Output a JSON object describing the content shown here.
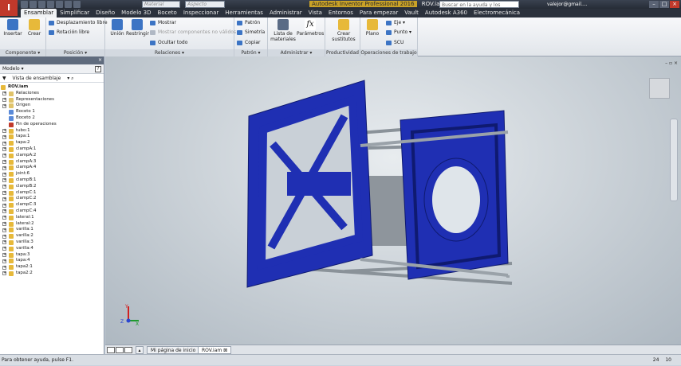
{
  "titlebar": {
    "material_placeholder": "Material",
    "appearance_placeholder": "Aspecto",
    "product": "Autodesk Inventor Professional 2016",
    "document": "ROV.iam",
    "search_placeholder": "Buscar en la ayuda y los comandos...",
    "user": "valejor@gmail...."
  },
  "tabs": [
    "Ensamblar",
    "Simplificar",
    "Diseño",
    "Modelo 3D",
    "Boceto",
    "Inspeccionar",
    "Herramientas",
    "Administrar",
    "Vista",
    "Entornos",
    "Para empezar",
    "Vault",
    "Autodesk A360",
    "Electromecánica"
  ],
  "ribbon": {
    "componente": {
      "label": "Componente ▾",
      "insertar": "Insertar",
      "crear": "Crear"
    },
    "posicion": {
      "label": "Posición ▾",
      "desplazamiento": "Desplazamiento libre",
      "rotacion": "Rotación libre"
    },
    "relaciones": {
      "label": "Relaciones ▾",
      "union": "Unión",
      "restringir": "Restringir",
      "mostrar": "Mostrar",
      "mostrar_comp": "Mostrar componentes no válidos",
      "ocultar": "Ocultar todo"
    },
    "patron": {
      "label": "Patrón ▾",
      "patron": "Patrón",
      "simetria": "Simetría",
      "copiar": "Copiar"
    },
    "administrar": {
      "label": "Administrar ▾",
      "lista": "Lista de materiales",
      "parametros": "Parámetros"
    },
    "productividad": {
      "label": "Productividad",
      "crear_sust": "Crear sustitutos"
    },
    "operaciones": {
      "label": "Operaciones de trabajo",
      "plano": "Plano",
      "eje": "Eje ▾",
      "punto": "Punto ▾",
      "scu": "SCU"
    }
  },
  "browser": {
    "title": "Modelo ▾",
    "view": "Vista de ensamblaje",
    "root": "ROV.iam",
    "items": [
      "Relaciones",
      "Representaciones",
      "Origen",
      "Boceto 1",
      "Boceto 2",
      "Fin de operaciones",
      "tubo:1",
      "tapa:1",
      "tapa:2",
      "clampA:1",
      "clampA:2",
      "clampA:3",
      "clampA:4",
      "joint:6",
      "clampB:1",
      "clampB:2",
      "clampC:1",
      "clampC:2",
      "clampC:3",
      "clampC:4",
      "lateral:1",
      "lateral:2",
      "varilla:1",
      "varilla:2",
      "varilla:3",
      "varilla:4",
      "tapa:3",
      "tapa:4",
      "tapa2:1",
      "tapa2:2"
    ]
  },
  "doc_tabs": {
    "home": "Mi página de inicio",
    "model": "ROV.iam"
  },
  "status": {
    "help": "Para obtener ayuda, pulse F1.",
    "count1": "24",
    "count2": "10"
  },
  "colors": {
    "model_blue": "#1f2fb3",
    "tube": "#8e959c",
    "accent_red": "#c0392b"
  }
}
